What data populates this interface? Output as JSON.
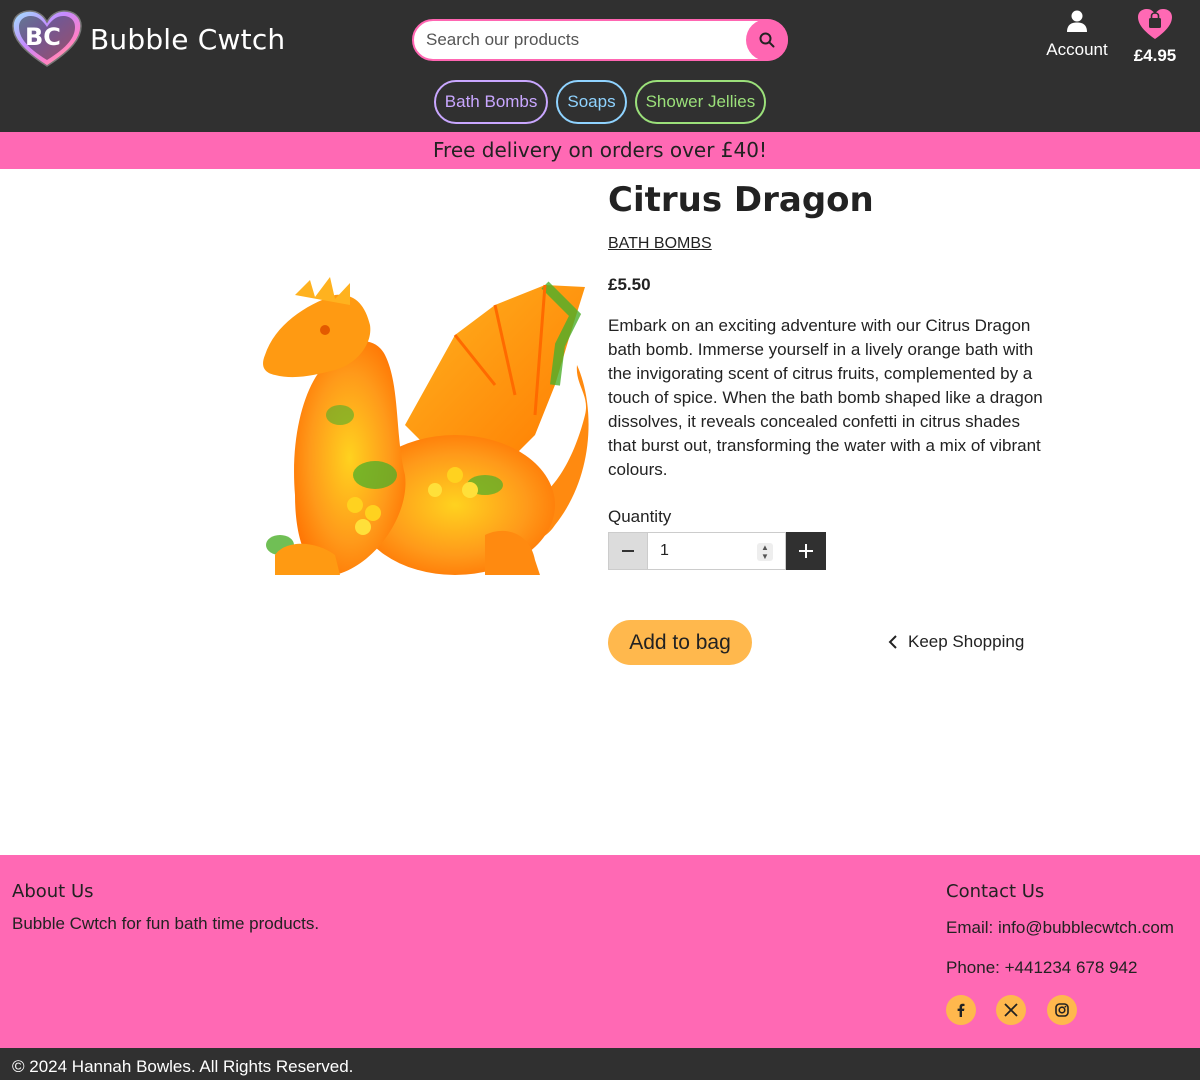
{
  "header": {
    "logo_initials": "BC",
    "brand_name": "Bubble Cwtch",
    "search_placeholder": "Search our products",
    "account_label": "Account",
    "bag_total": "£4.95"
  },
  "nav": {
    "items": [
      {
        "label": "Bath Bombs",
        "color": "#c9a7ff"
      },
      {
        "label": "Soaps",
        "color": "#8fd3ff"
      },
      {
        "label": "Shower Jellies",
        "color": "#9be07a"
      }
    ]
  },
  "banner": {
    "text": "Free delivery on orders over £40!"
  },
  "product": {
    "title": "Citrus Dragon",
    "category": "BATH BOMBS",
    "price": "£5.50",
    "description": "Embark on an exciting adventure with our Citrus Dragon bath bomb. Immerse yourself in a lively orange bath with the invigorating scent of citrus fruits, complemented by a touch of spice. When the bath bomb shaped like a dragon dissolves, it reveals concealed confetti in citrus shades that burst out, transforming the water with a mix of vibrant colours.",
    "quantity_label": "Quantity",
    "quantity_value": "1",
    "add_to_bag_label": "Add to bag",
    "keep_shopping_label": "Keep Shopping"
  },
  "footer": {
    "about_heading": "About Us",
    "about_text": "Bubble Cwtch for fun bath time products.",
    "contact_heading": "Contact Us",
    "email_text": "Email: info@bubblecwtch.com",
    "phone_text": "Phone: +441234 678 942",
    "social_icons": [
      "facebook-icon",
      "x-icon",
      "instagram-icon"
    ],
    "copyright": "© 2024 Hannah Bowles. All Rights Reserved."
  },
  "colors": {
    "header_bg": "#303030",
    "accent_pink": "#ff69b4",
    "accent_orange": "#ffb84d"
  }
}
